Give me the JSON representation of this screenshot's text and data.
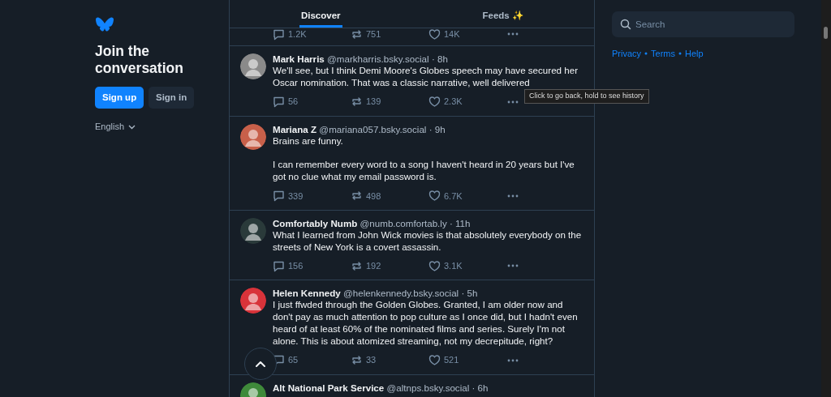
{
  "sidebar": {
    "heading": "Join the conversation",
    "buttons": [
      {
        "label": "Sign up",
        "kind": "primary"
      },
      {
        "label": "Sign in",
        "kind": "secondary"
      }
    ],
    "language": "English"
  },
  "tabs": [
    {
      "label": "Discover",
      "selected": true
    },
    {
      "label": "Feeds ✨",
      "selected": false
    }
  ],
  "posts": [
    {
      "stats": [
        "1.2K",
        "751",
        "14K"
      ]
    },
    {
      "author": "Mark Harris",
      "handle": "@markharris.bsky.social",
      "time": "· 8h",
      "color": "#8a8a8a",
      "paragraphs": [
        "We'll see, but I think Demi Moore's Globes speech may have secured her Oscar nomination. That was a classic narrative, well delivered"
      ],
      "stats": [
        "56",
        "139",
        "2.3K"
      ]
    },
    {
      "author": "Mariana Z",
      "handle": "@mariana057.bsky.social",
      "time": "· 9h",
      "color": "#c8604a",
      "paragraphs": [
        "Brains are funny.",
        "I can remember every word to a song I haven't heard in 20 years but I've got no clue what my email password is."
      ],
      "stats": [
        "339",
        "498",
        "6.7K"
      ]
    },
    {
      "author": "Comfortably Numb",
      "handle": "@numb.comfortab.ly",
      "time": "· 11h",
      "color": "#2a3a3a",
      "paragraphs": [
        "What I learned from John Wick movies is that absolutely everybody on the streets of New York is a covert assassin."
      ],
      "stats": [
        "156",
        "192",
        "3.1K"
      ]
    },
    {
      "author": "Helen Kennedy",
      "handle": "@helenkennedy.bsky.social",
      "time": "· 5h",
      "color": "#d8333a",
      "paragraphs": [
        "I just ffwded through the Golden Globes. Granted, I am older now and don't pay as much attention to pop culture as I once did, but I hadn't even heard of at least 60% of the nominated films and series. Surely I'm not alone. This is about atomized streaming, not my decrepitude, right?"
      ],
      "stats": [
        "65",
        "33",
        "521"
      ]
    },
    {
      "author": "Alt National Park Service",
      "handle": "@altnps.bsky.social",
      "time": "· 6h",
      "color": "#3f8a3a"
    }
  ],
  "search": {
    "placeholder": "Search"
  },
  "footer_links": [
    "Privacy",
    "Terms",
    "Help"
  ],
  "tooltip": "Click to go back, hold to see history"
}
